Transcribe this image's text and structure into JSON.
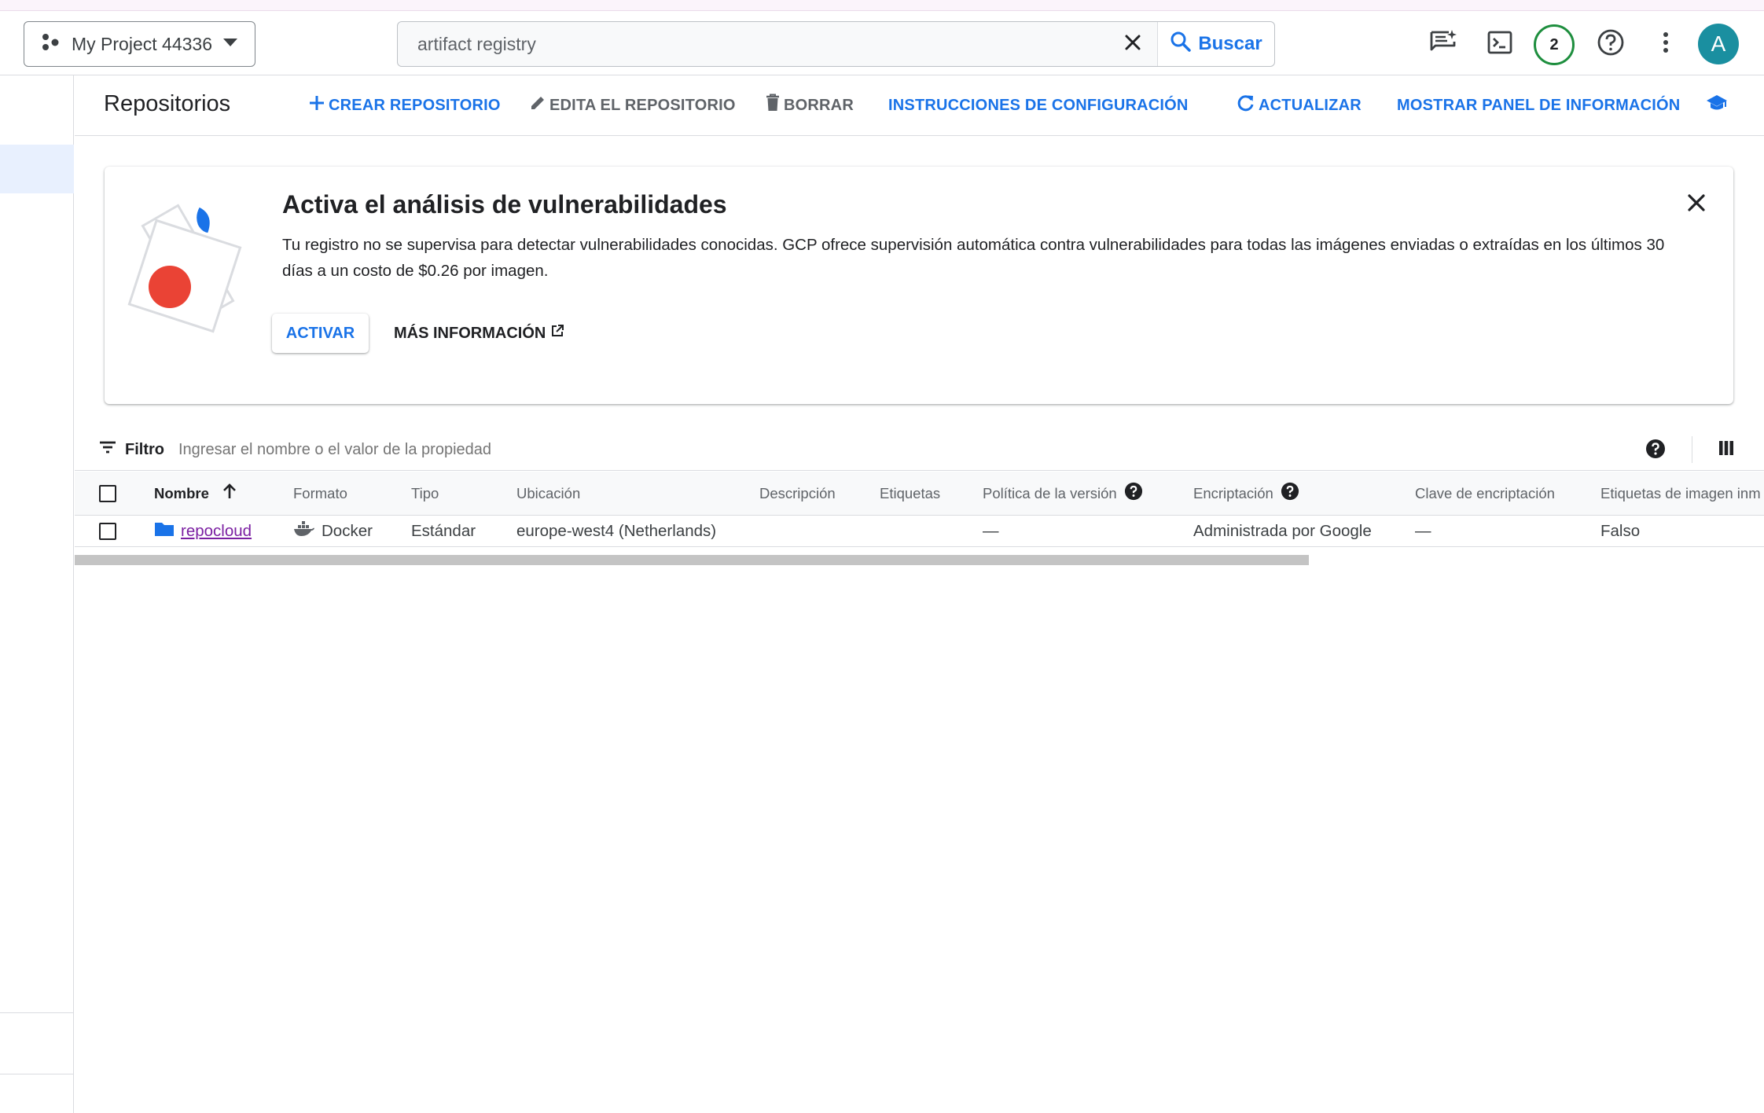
{
  "header": {
    "project_name": "My Project 44336",
    "search_value": "artifact registry",
    "search_button": "Buscar",
    "notifications_count": "2",
    "avatar_initial": "A"
  },
  "toolbar": {
    "title": "Repositorios",
    "create": "CREAR REPOSITORIO",
    "edit": "EDITA EL REPOSITORIO",
    "delete": "BORRAR",
    "setup": "INSTRUCCIONES DE CONFIGURACIÓN",
    "refresh": "ACTUALIZAR",
    "info_panel": "MOSTRAR PANEL DE INFORMACIÓN"
  },
  "banner": {
    "title": "Activa el análisis de vulnerabilidades",
    "text": "Tu registro no se supervisa para detectar vulnerabilidades conocidas. GCP ofrece supervisión automática contra vulnerabilidades para todas las imágenes enviadas o extraídas en los últimos 30 días a un costo de $0.26 por imagen.",
    "activate": "ACTIVAR",
    "more_info": "MÁS INFORMACIÓN"
  },
  "filter": {
    "label": "Filtro",
    "placeholder": "Ingresar el nombre o el valor de la propiedad"
  },
  "table": {
    "columns": {
      "name": "Nombre",
      "format": "Formato",
      "type": "Tipo",
      "location": "Ubicación",
      "description": "Descripción",
      "labels": "Etiquetas",
      "version_policy": "Política de la versión",
      "encryption": "Encriptación",
      "encryption_key": "Clave de encriptación",
      "immutable_tags": "Etiquetas de imagen inm"
    },
    "rows": [
      {
        "name": "repocloud",
        "format": "Docker",
        "type": "Estándar",
        "location": "europe-west4 (Netherlands)",
        "description": "",
        "labels": "",
        "version_policy": "—",
        "encryption": "Administrada por Google",
        "encryption_key": "—",
        "immutable_tags": "Falso"
      }
    ]
  },
  "colors": {
    "accent": "#1a73e8",
    "link_visited": "#7b1fa2",
    "notif_ring": "#1e8e3e"
  },
  "icons": {
    "project": "project-nodes-icon",
    "dropdown": "caret-down-icon",
    "clear": "close-icon",
    "search": "search-icon",
    "feedback": "chat-spark-icon",
    "terminal": "terminal-icon",
    "help": "help-circle-icon",
    "more": "more-vert-icon",
    "learn": "school-icon",
    "external": "open-in-new-icon",
    "filter": "filter-list-icon",
    "columns": "view-column-icon",
    "folder": "folder-icon",
    "docker": "docker-whale-icon",
    "sort": "arrow-up-icon"
  }
}
